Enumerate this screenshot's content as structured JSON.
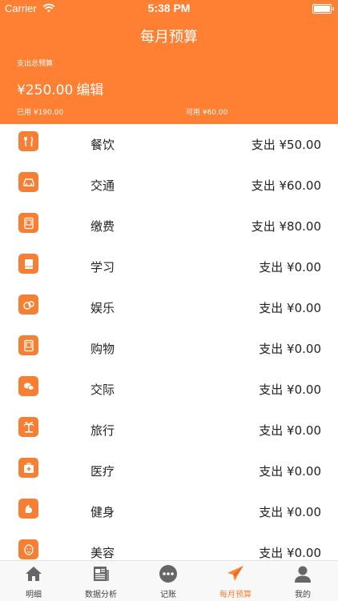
{
  "status_bar": {
    "carrier": "Carrier",
    "time": "5:38 PM"
  },
  "nav": {
    "title": "每月预算"
  },
  "budget": {
    "label": "支出总预算",
    "amount": "¥250.00",
    "edit": "编辑",
    "used": "已用 ¥190.00",
    "available": "可用 ¥60.00"
  },
  "categories": [
    {
      "name": "餐饮",
      "amount": "支出 ¥50.00",
      "icon": "fork-knife-icon"
    },
    {
      "name": "交通",
      "amount": "支出 ¥60.00",
      "icon": "car-icon"
    },
    {
      "name": "缴费",
      "amount": "支出 ¥80.00",
      "icon": "bill-icon"
    },
    {
      "name": "学习",
      "amount": "支出 ¥0.00",
      "icon": "book-icon"
    },
    {
      "name": "娱乐",
      "amount": "支出 ¥0.00",
      "icon": "entertainment-icon"
    },
    {
      "name": "购物",
      "amount": "支出 ¥0.00",
      "icon": "shopping-icon"
    },
    {
      "name": "交际",
      "amount": "支出 ¥0.00",
      "icon": "chat-icon"
    },
    {
      "name": "旅行",
      "amount": "支出 ¥0.00",
      "icon": "palm-tree-icon"
    },
    {
      "name": "医疗",
      "amount": "支出 ¥0.00",
      "icon": "medical-kit-icon"
    },
    {
      "name": "健身",
      "amount": "支出 ¥0.00",
      "icon": "muscle-arm-icon"
    },
    {
      "name": "美容",
      "amount": "支出 ¥0.00",
      "icon": "face-mask-icon"
    }
  ],
  "tabs": [
    {
      "label": "明细",
      "icon": "home-icon",
      "active": false
    },
    {
      "label": "数据分析",
      "icon": "newspaper-icon",
      "active": false
    },
    {
      "label": "记账",
      "icon": "more-dots-icon",
      "active": false
    },
    {
      "label": "每月预算",
      "icon": "paper-plane-icon",
      "active": true
    },
    {
      "label": "我的",
      "icon": "user-icon",
      "active": false
    }
  ],
  "colors": {
    "accent": "#FF7F33",
    "tab_inactive": "#666666"
  }
}
